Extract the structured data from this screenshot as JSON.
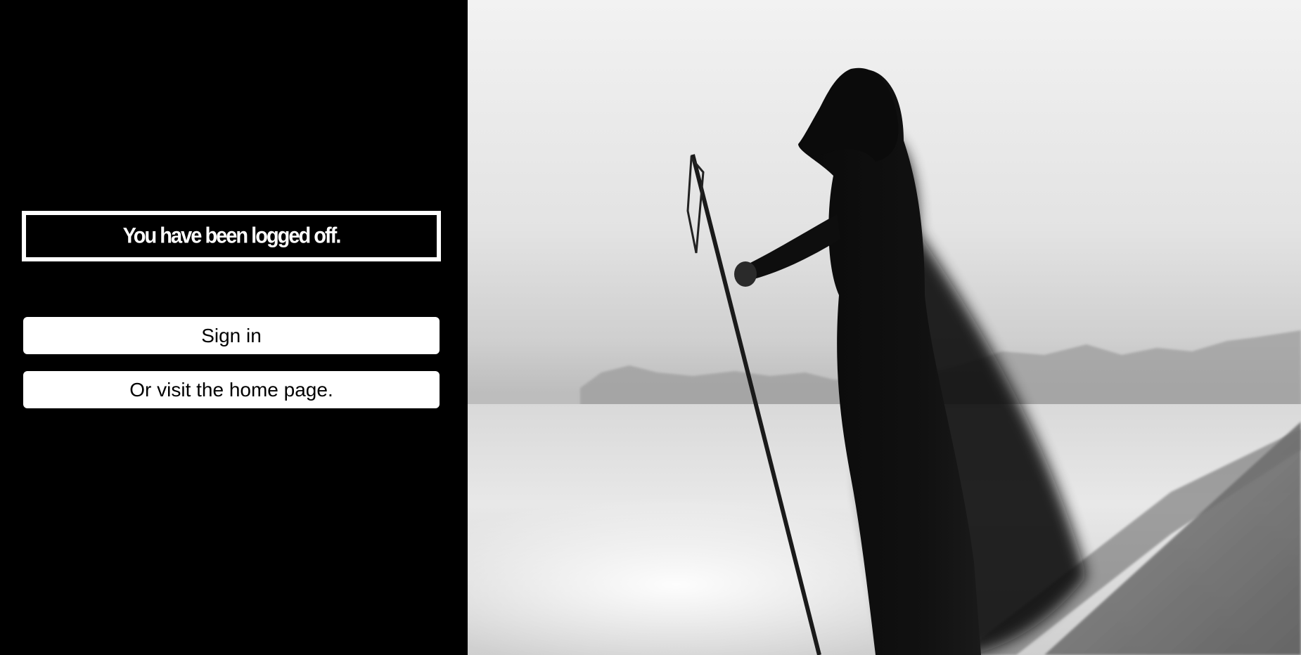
{
  "status": {
    "message": "You have been logged off."
  },
  "actions": {
    "sign_in_label": "Sign in",
    "home_label": "Or visit the home page."
  },
  "image": {
    "description_icon": "hooded-figure-beach-photo"
  },
  "colors": {
    "panel_background": "#000000",
    "button_background": "#ffffff",
    "text_light": "#ffffff",
    "text_dark": "#000000"
  }
}
